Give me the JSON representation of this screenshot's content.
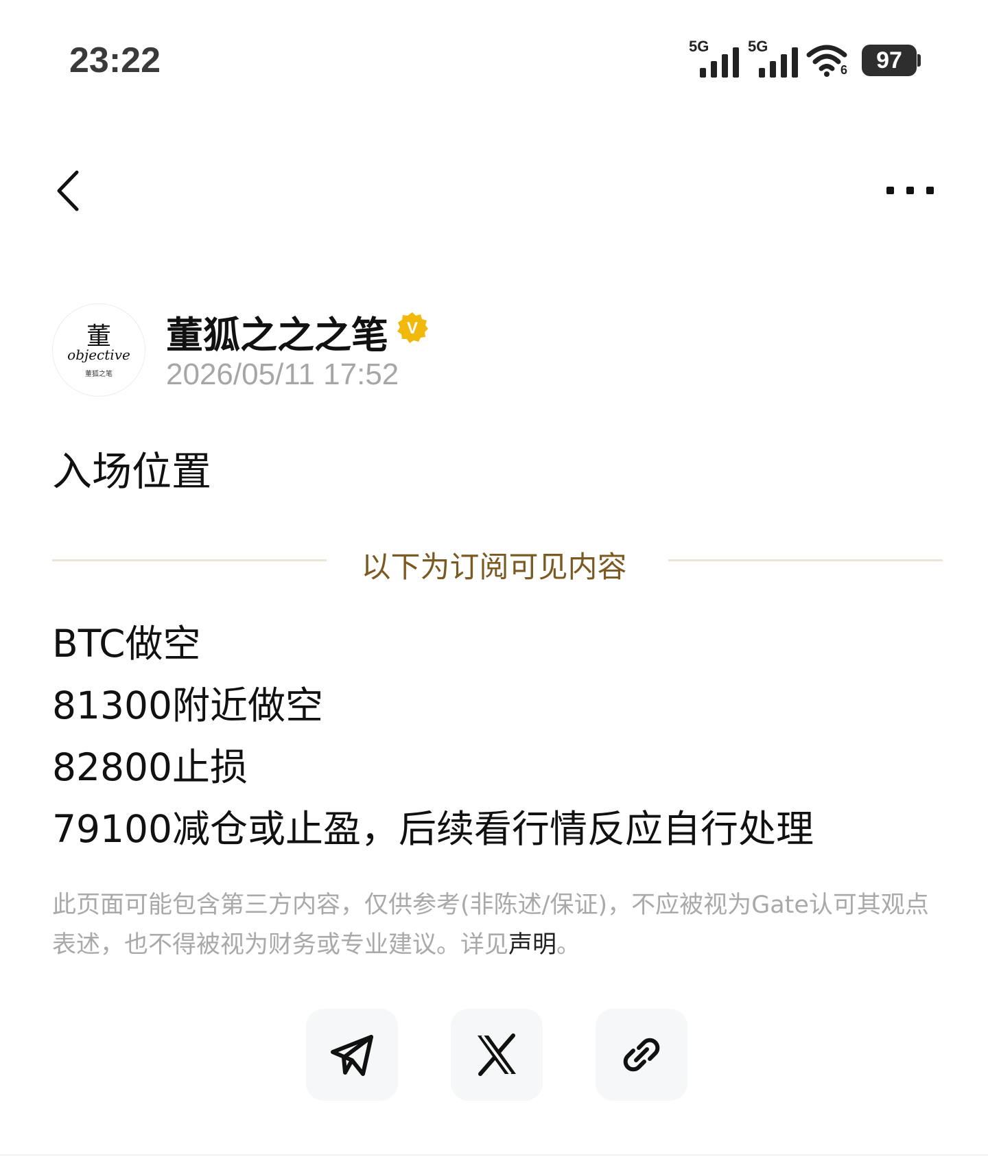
{
  "status_bar": {
    "time": "23:22",
    "sim1_label": "5G",
    "sim2_label": "5G",
    "wifi_label": "6",
    "battery_level": "97",
    "icons": [
      "signal-icon",
      "signal-icon",
      "wifi-icon",
      "battery-icon"
    ]
  },
  "nav": {
    "back_icon": "chevron-left-icon",
    "more_icon": "more-dots-icon"
  },
  "author": {
    "name": "董狐之之之笔",
    "verified_badge": "V",
    "verified_color": "#f0b90b",
    "post_time": "2026/05/11 17:52",
    "avatar": {
      "top_char": "董",
      "script": "objective",
      "bottom_text": "董狐之笔"
    }
  },
  "post": {
    "title": "入场位置",
    "subscription_divider": "以下为订阅可见内容",
    "divider_color": "#7a5a21",
    "lines": [
      "BTC做空",
      "81300附近做空",
      "82800止损",
      "79100减仓或止盈，后续看行情反应自行处理"
    ]
  },
  "disclaimer": {
    "text": "此页面可能包含第三方内容，仅供参考(非陈述/保证)，不应被视为Gate认可其观点表述，也不得被视为财务或专业建议。详见",
    "link": "声明",
    "end": "。"
  },
  "share": {
    "buttons": [
      {
        "name": "telegram-share-button",
        "icon": "telegram-icon"
      },
      {
        "name": "x-share-button",
        "icon": "x-logo-icon"
      },
      {
        "name": "copy-link-button",
        "icon": "link-icon"
      }
    ]
  }
}
